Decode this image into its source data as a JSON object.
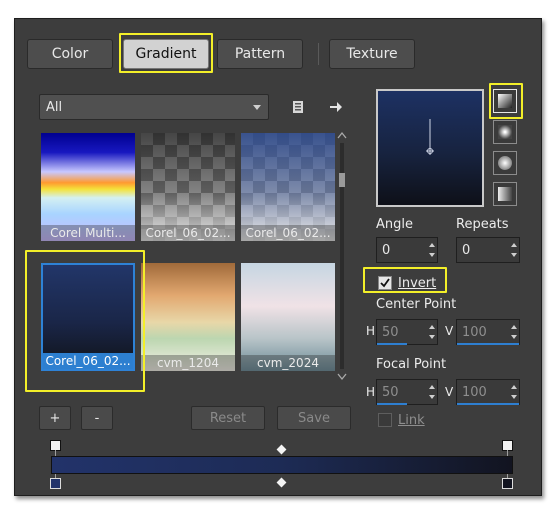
{
  "tabs": [
    {
      "label": "Color",
      "active": false
    },
    {
      "label": "Gradient",
      "active": true
    },
    {
      "label": "Pattern",
      "active": false
    },
    {
      "label": "Texture",
      "active": false
    }
  ],
  "category": {
    "selected": "All"
  },
  "swatches": [
    {
      "caption": "Corel Multi..."
    },
    {
      "caption": "Corel_06_02..."
    },
    {
      "caption": "Corel_06_02..."
    },
    {
      "caption": "Corel_06_02...",
      "selected": true
    },
    {
      "caption": "cvm_1204"
    },
    {
      "caption": "cvm_2024"
    }
  ],
  "actions": {
    "add": "+",
    "remove": "-",
    "reset": "Reset",
    "save": "Save"
  },
  "style_icons": [
    "linear-gradient-icon",
    "rectangular-gradient-icon",
    "sunburst-gradient-icon",
    "radial-gradient-icon"
  ],
  "controls": {
    "angle_label": "Angle",
    "angle_value": "0",
    "repeats_label": "Repeats",
    "repeats_value": "0",
    "invert_label": "Invert",
    "invert_checked": true,
    "center_point_label": "Center Point",
    "center_h_label": "H",
    "center_h_value": "50",
    "center_v_label": "V",
    "center_v_value": "100",
    "focal_point_label": "Focal Point",
    "focal_h_label": "H",
    "focal_h_value": "50",
    "focal_v_label": "V",
    "focal_v_value": "100",
    "link_label": "Link",
    "link_checked": false
  },
  "gradient_colors": {
    "start": "#22336a",
    "end": "#121420"
  },
  "highlight_color": "#f3ef29"
}
